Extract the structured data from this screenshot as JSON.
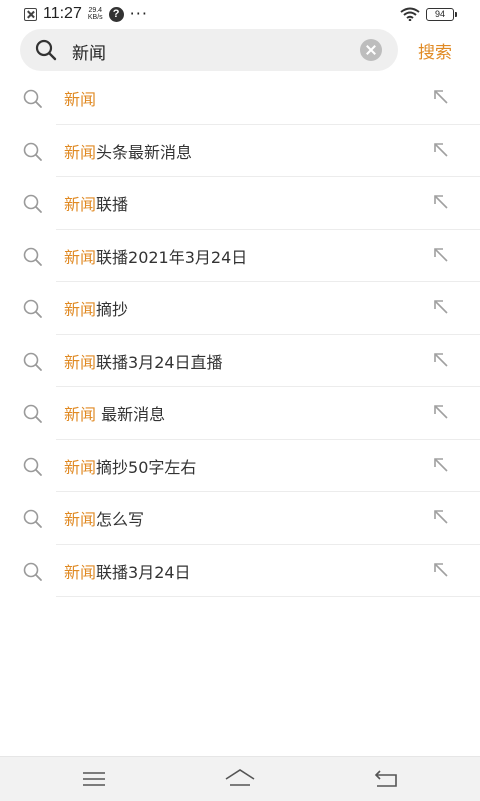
{
  "status_bar": {
    "time": "11:27",
    "net_speed_value": "29.4",
    "net_speed_unit": "KB/s",
    "help_glyph": "?",
    "more": "···",
    "battery": "94",
    "icons": [
      "notification-x-icon",
      "help-circle-icon",
      "wifi-icon",
      "battery-icon"
    ]
  },
  "search": {
    "query": "新闻",
    "submit_label": "搜索",
    "accent_color": "#e08a24"
  },
  "suggestions": [
    {
      "highlight": "新闻",
      "rest": ""
    },
    {
      "highlight": "新闻",
      "rest": "头条最新消息"
    },
    {
      "highlight": "新闻",
      "rest": "联播"
    },
    {
      "highlight": "新闻",
      "rest": "联播2021年3月24日"
    },
    {
      "highlight": "新闻",
      "rest": "摘抄"
    },
    {
      "highlight": "新闻",
      "rest": "联播3月24日直播"
    },
    {
      "highlight": "新闻",
      "rest": " 最新消息"
    },
    {
      "highlight": "新闻",
      "rest": "摘抄50字左右"
    },
    {
      "highlight": "新闻",
      "rest": "怎么写"
    },
    {
      "highlight": "新闻",
      "rest": "联播3月24日"
    }
  ],
  "nav": {
    "icons": [
      "menu-icon",
      "home-icon",
      "back-icon"
    ]
  }
}
